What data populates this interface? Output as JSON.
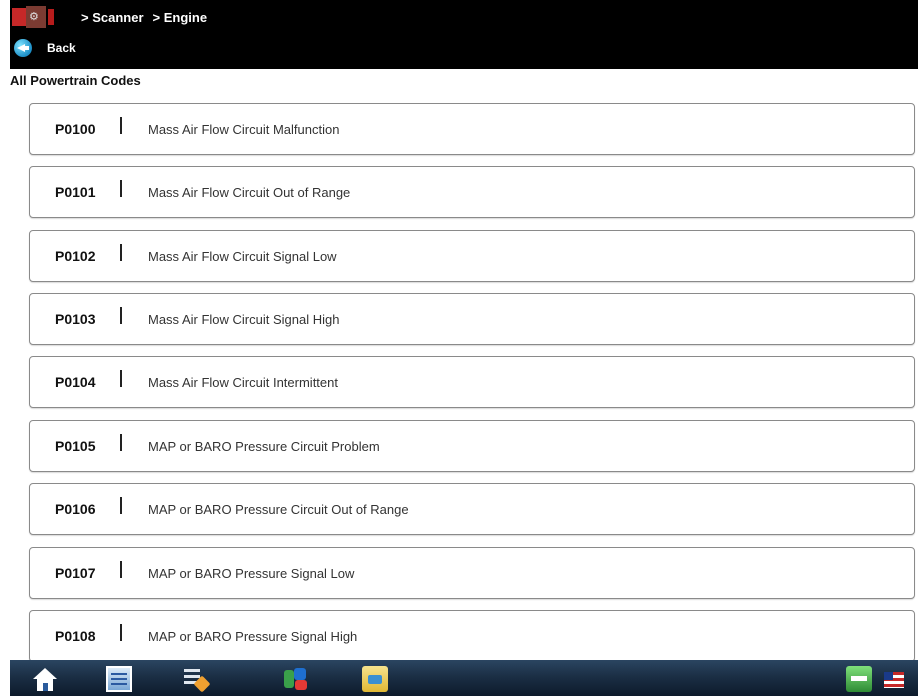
{
  "header": {
    "breadcrumb": [
      "> Scanner",
      "> Engine"
    ],
    "back_label": "Back"
  },
  "section_title": "All Powertrain Codes",
  "codes": [
    {
      "id": "P0100",
      "desc": "Mass Air Flow Circuit Malfunction"
    },
    {
      "id": "P0101",
      "desc": "Mass Air Flow Circuit Out of Range"
    },
    {
      "id": "P0102",
      "desc": "Mass Air Flow Circuit Signal Low"
    },
    {
      "id": "P0103",
      "desc": "Mass Air Flow Circuit Signal High"
    },
    {
      "id": "P0104",
      "desc": "Mass Air Flow Circuit Intermittent"
    },
    {
      "id": "P0105",
      "desc": "MAP or BARO Pressure Circuit Problem"
    },
    {
      "id": "P0106",
      "desc": "MAP or BARO Pressure Circuit Out of Range"
    },
    {
      "id": "P0107",
      "desc": "MAP or BARO Pressure Signal Low"
    },
    {
      "id": "P0108",
      "desc": "MAP or BARO Pressure Signal High"
    }
  ],
  "taskbar": {
    "icons": [
      "home-icon",
      "document-icon",
      "list-icon",
      "scanner-icon",
      "folder-icon",
      "status-icon",
      "flag-icon"
    ]
  },
  "colors": {
    "header_bg": "#000000",
    "taskbar_bg": "#1b2f45",
    "row_border": "#8a8a8a"
  }
}
